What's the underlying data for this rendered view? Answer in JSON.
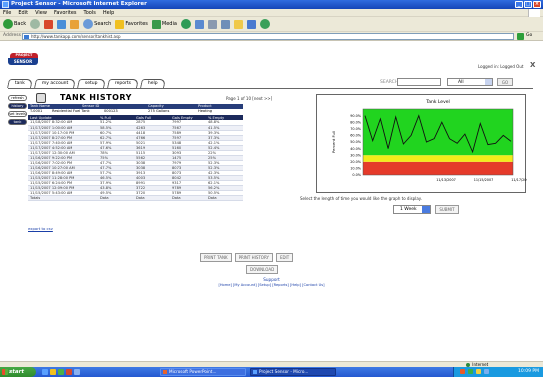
{
  "window": {
    "title": "Project Sensor - Microsoft Internet Explorer"
  },
  "menu": [
    "File",
    "Edit",
    "View",
    "Favorites",
    "Tools",
    "Help"
  ],
  "toolbar": {
    "back": "Back",
    "search": "Search",
    "favorites": "Favorites",
    "media": "Media"
  },
  "address": {
    "label": "Address",
    "url": "http://www.tankapp.com/sensor/tankhist.asp",
    "go": "Go"
  },
  "page": {
    "logo_top": "PROJECT",
    "logo_bottom": "SENSOR",
    "logged_in": "Logged in: Logged Out",
    "close": "X",
    "tabs": [
      "tank",
      "my account",
      "setup",
      "reports",
      "help"
    ],
    "search": {
      "label": "SEARCH",
      "select": "All",
      "go": "GO"
    },
    "side_buttons": [
      "refresh",
      "history",
      "set levels",
      "tank details"
    ],
    "title": "TANK HISTORY",
    "page_info": "Page 1 of 10 [next >>]",
    "meta": {
      "headers": [
        "Tank Name",
        "Sensor ID",
        "Capacity",
        "Product"
      ],
      "values": [
        "T-0001",
        "Residential Fuel Tank",
        "000123",
        "275 Gallons",
        "Heating"
      ]
    },
    "history": {
      "headers": [
        "Last Update",
        "% Full",
        "Gals Full",
        "Gals Empty",
        "% Empty"
      ],
      "rows": [
        [
          "11/18/2007 8:32:00 AM",
          "51.2%",
          "2875",
          "7997",
          "48.8%"
        ],
        [
          "11/17/2007 1:00:00 AM",
          "58.5%",
          "4263",
          "7567",
          "41.5%"
        ],
        [
          "11/17/2007 10:17:00 PM",
          "60.7%",
          "4418",
          "7589",
          "39.3%"
        ],
        [
          "11/17/2007 8:27:00 PM",
          "62.7%",
          "4766",
          "7597",
          "37.3%"
        ],
        [
          "11/17/2007 7:40:00 AM",
          "57.9%",
          "5021",
          "5348",
          "42.1%"
        ],
        [
          "11/17/2007 4:52:00 AM",
          "47.6%",
          "3619",
          "5160",
          "52.4%"
        ],
        [
          "11/17/2007 12:30:00 AM",
          "78%",
          "5115",
          "3093",
          "22%"
        ],
        [
          "11/16/2007 9:22:00 PM",
          "75%",
          "5562",
          "1475",
          "25%"
        ],
        [
          "11/16/2007 7:02:00 PM",
          "47.7%",
          "3038",
          "7979",
          "52.3%"
        ],
        [
          "11/16/2007 10:27:00 AM",
          "47.7%",
          "3038",
          "8073",
          "52.3%"
        ],
        [
          "11/16/2007 8:49:00 AM",
          "57.7%",
          "3913",
          "8073",
          "42.3%"
        ],
        [
          "11/15/2007 11:28:00 PM",
          "46.5%",
          "4003",
          "8042",
          "53.5%"
        ],
        [
          "11/15/2007 6:24:00 PM",
          "37.9%",
          "8991",
          "9317",
          "62.1%"
        ],
        [
          "11/15/2007 12:09:00 PM",
          "43.8%",
          "3722",
          "9789",
          "56.2%"
        ],
        [
          "11/15/2007 5:43:00 AM",
          "49.5%",
          "3720",
          "5789",
          "50.5%"
        ],
        [
          "Totals",
          "Data",
          "Data",
          "Data",
          "Data"
        ]
      ]
    },
    "foot_link": "export to csv",
    "chart_note": "Select the length of time you would like the graph to display.",
    "period_select": "1 Week",
    "submit": "SUBMIT",
    "actions": [
      "PRINT TANK",
      "PRINT HISTORY",
      "EDIT"
    ],
    "download": "DOWNLOAD",
    "support": "Support",
    "support_links": "[Home] [My Account] [Setup] [Reports] [Help] [Contact Us]"
  },
  "chart_data": {
    "type": "line",
    "title": "Tank Level",
    "ylabel": "Percent Full",
    "ylim": [
      0,
      100
    ],
    "yticks": [
      "0.0%",
      "10.0%",
      "20.0%",
      "30.0%",
      "40.0%",
      "50.0%",
      "60.0%",
      "70.0%",
      "80.0%",
      "90.0%"
    ],
    "xticks": [
      "11/13/2007",
      "11/15/2007",
      "11/17/2007"
    ],
    "bands": [
      {
        "from": 0,
        "to": 20,
        "color": "#e53a2a"
      },
      {
        "from": 20,
        "to": 30,
        "color": "#f2ec1a"
      },
      {
        "from": 30,
        "to": 100,
        "color": "#21d41f"
      }
    ],
    "series": [
      {
        "values": [
          90,
          52,
          85,
          40,
          88,
          47,
          60,
          90,
          50,
          55,
          80,
          55,
          48,
          62,
          35,
          78,
          46,
          48,
          60,
          51
        ],
        "color": "#111111"
      }
    ]
  },
  "statusbar": {
    "zone": "Internet"
  },
  "taskbar": {
    "start": "start",
    "tasks": [
      "Microsoft PowerPoint...",
      "Project Sensor - Micro..."
    ],
    "clock": "10:09 PM"
  }
}
